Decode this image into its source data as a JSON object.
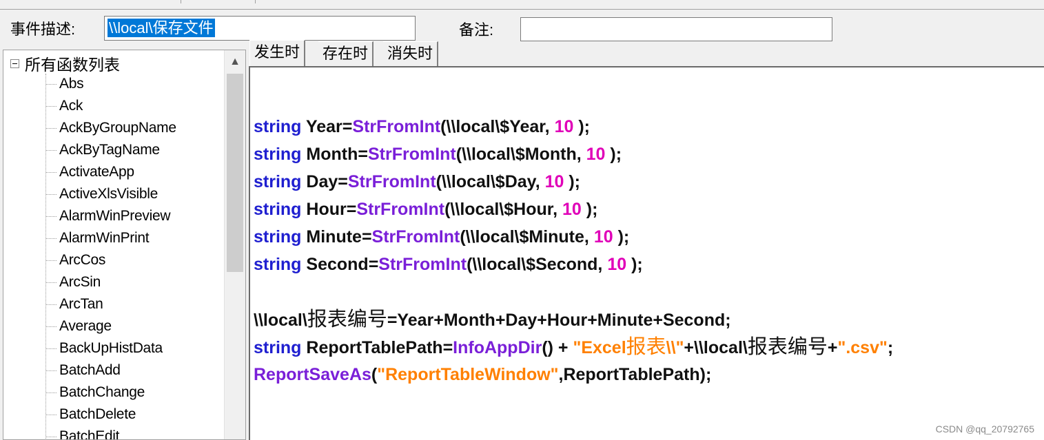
{
  "header": {
    "event_desc_label": "事件描述:",
    "event_desc_value": "\\\\local\\保存文件",
    "note_label": "备注:",
    "note_value": ""
  },
  "tree": {
    "root_label": "所有函数列表",
    "items": [
      "Abs",
      "Ack",
      "AckByGroupName",
      "AckByTagName",
      "ActivateApp",
      "ActiveXlsVisible",
      "AlarmWinPreview",
      "AlarmWinPrint",
      "ArcCos",
      "ArcSin",
      "ArcTan",
      "Average",
      "BackUpHistData",
      "BatchAdd",
      "BatchChange",
      "BatchDelete",
      "BatchEdit"
    ],
    "scroll_up_icon": "chevron-up-icon"
  },
  "tabs": [
    "发生时",
    "存在时",
    "消失时"
  ],
  "code": {
    "lines": [
      [],
      [],
      [
        [
          "kw",
          "string"
        ],
        [
          "txt",
          " Year="
        ],
        [
          "fn",
          "StrFromInt"
        ],
        [
          "txt",
          "(\\\\local\\$Year, "
        ],
        [
          "num",
          "10"
        ],
        [
          "txt",
          " );"
        ]
      ],
      [
        [
          "kw",
          "string"
        ],
        [
          "txt",
          " Month="
        ],
        [
          "fn",
          "StrFromInt"
        ],
        [
          "txt",
          "(\\\\local\\$Month, "
        ],
        [
          "num",
          "10"
        ],
        [
          "txt",
          " );"
        ]
      ],
      [
        [
          "kw",
          "string"
        ],
        [
          "txt",
          " Day="
        ],
        [
          "fn",
          "StrFromInt"
        ],
        [
          "txt",
          "(\\\\local\\$Day, "
        ],
        [
          "num",
          "10"
        ],
        [
          "txt",
          " );"
        ]
      ],
      [
        [
          "kw",
          "string"
        ],
        [
          "txt",
          " Hour="
        ],
        [
          "fn",
          "StrFromInt"
        ],
        [
          "txt",
          "(\\\\local\\$Hour, "
        ],
        [
          "num",
          "10"
        ],
        [
          "txt",
          " );"
        ]
      ],
      [
        [
          "kw",
          "string"
        ],
        [
          "txt",
          " Minute="
        ],
        [
          "fn",
          "StrFromInt"
        ],
        [
          "txt",
          "(\\\\local\\$Minute, "
        ],
        [
          "num",
          "10"
        ],
        [
          "txt",
          " );"
        ]
      ],
      [
        [
          "kw",
          "string"
        ],
        [
          "txt",
          " Second="
        ],
        [
          "fn",
          "StrFromInt"
        ],
        [
          "txt",
          "(\\\\local\\$Second, "
        ],
        [
          "num",
          "10"
        ],
        [
          "txt",
          " );"
        ]
      ],
      [],
      [
        [
          "txt",
          "\\\\local\\"
        ],
        [
          "txtbig",
          "报表编号"
        ],
        [
          "txt",
          "=Year+Month+Day+Hour+Minute+Second;"
        ]
      ],
      [
        [
          "kw",
          "string"
        ],
        [
          "txt",
          " ReportTablePath="
        ],
        [
          "fn",
          "InfoAppDir"
        ],
        [
          "txt",
          "() + "
        ],
        [
          "str",
          "\"Excel"
        ],
        [
          "strbig",
          "报表"
        ],
        [
          "str",
          "\\\\\""
        ],
        [
          "txt",
          "+\\\\local\\"
        ],
        [
          "txtbig",
          "报表编号"
        ],
        [
          "txt",
          "+"
        ],
        [
          "str",
          "\".csv\""
        ],
        [
          "txt",
          ";"
        ]
      ],
      [
        [
          "fn",
          "ReportSaveAs"
        ],
        [
          "txt",
          "("
        ],
        [
          "str",
          "\"ReportTableWindow\""
        ],
        [
          "txt",
          ",ReportTablePath);"
        ]
      ]
    ]
  },
  "watermark": "CSDN @qq_20792765"
}
